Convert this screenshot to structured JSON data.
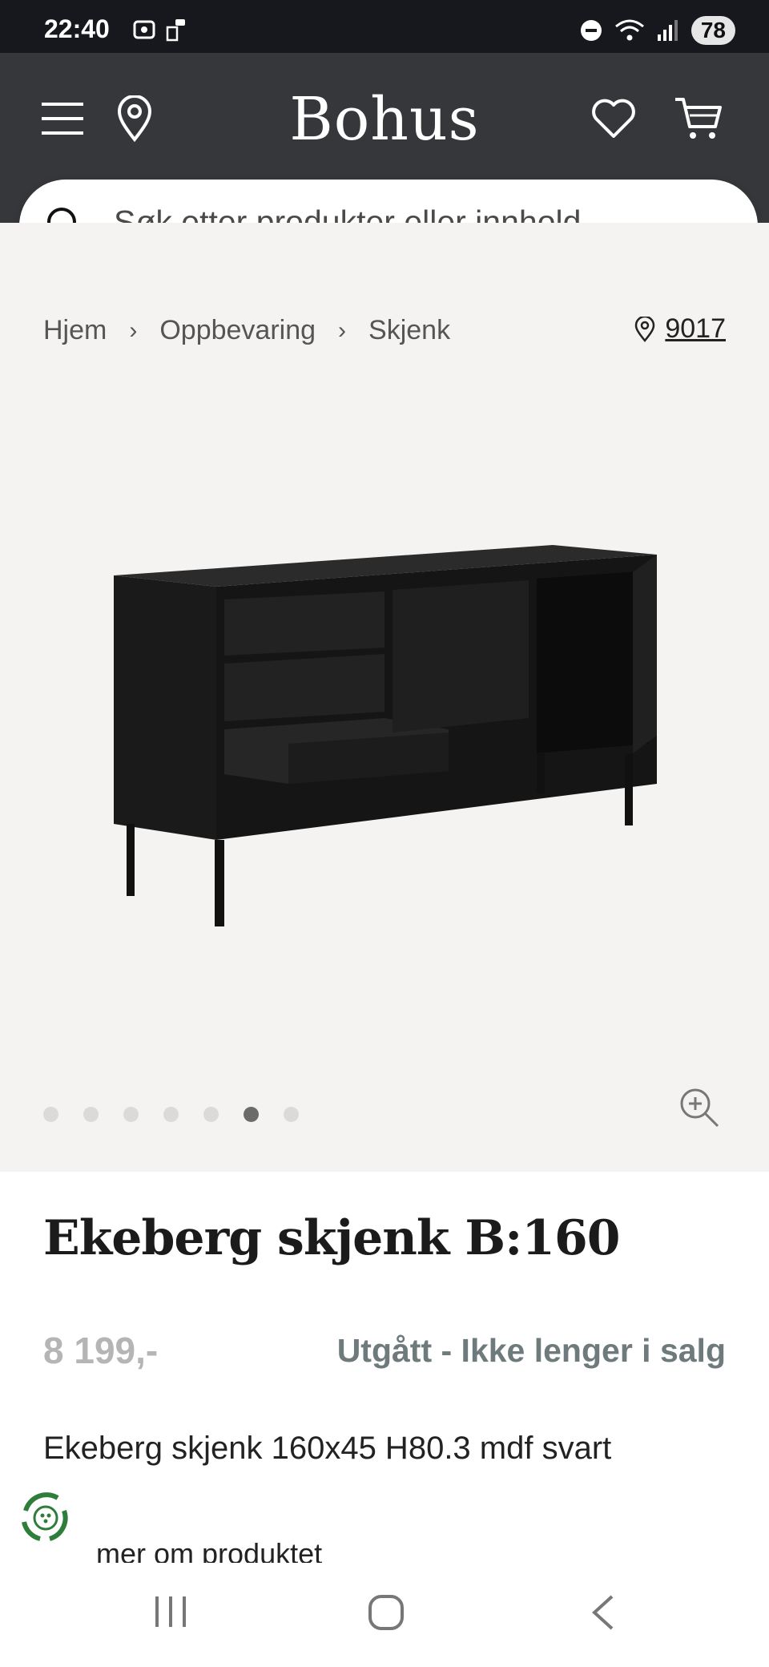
{
  "status_bar": {
    "time": "22:40",
    "battery": "78"
  },
  "header": {
    "logo": "Bohus"
  },
  "search": {
    "placeholder": "Søk etter produkter eller innhold..."
  },
  "breadcrumb": {
    "items": [
      "Hjem",
      "Oppbevaring",
      "Skjenk"
    ],
    "store_code": "9017"
  },
  "gallery": {
    "image_count": 7,
    "active_index": 5
  },
  "product": {
    "title": "Ekeberg skjenk B:160",
    "price": "8 199,-",
    "availability": "Utgått - Ikke lenger i salg",
    "description": "Ekeberg skjenk 160x45 H80.3 mdf svart",
    "more_link": "mer om produktet"
  },
  "colors": {
    "header_bg": "#36373b",
    "status_bg": "#16181d",
    "gallery_bg": "#f5f3f1",
    "price": "#b5b5b5",
    "availability": "#6e7a7c"
  }
}
